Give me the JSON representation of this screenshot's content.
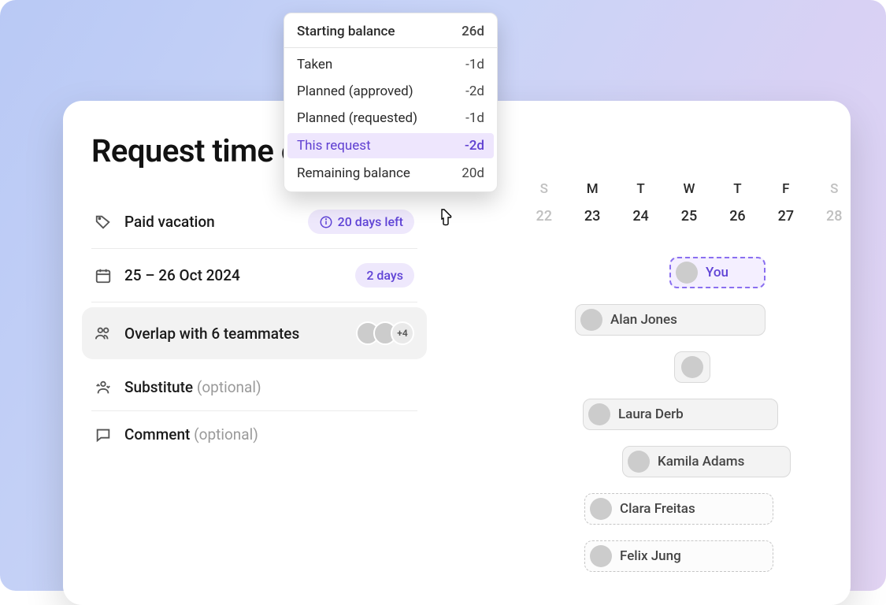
{
  "title": "Request time off",
  "form": {
    "type_label": "Paid vacation",
    "balance_pill": "20 days left",
    "date_label": "25 – 26 Oct 2024",
    "duration_pill": "2 days",
    "overlap_label": "Overlap with 6 teammates",
    "overlap_more": "+4",
    "substitute_label": "Substitute",
    "substitute_optional": "(optional)",
    "comment_label": "Comment",
    "comment_optional": "(optional)"
  },
  "tooltip": {
    "starting_label": "Starting balance",
    "starting_value": "26d",
    "rows": [
      {
        "label": "Taken",
        "value": "-1d"
      },
      {
        "label": "Planned (approved)",
        "value": "-2d"
      },
      {
        "label": "Planned (requested)",
        "value": "-1d"
      }
    ],
    "this_label": "This request",
    "this_value": "-2d",
    "remaining_label": "Remaining balance",
    "remaining_value": "20d"
  },
  "calendar": {
    "dow": [
      "S",
      "M",
      "T",
      "W",
      "T",
      "F",
      "S"
    ],
    "dates": [
      "22",
      "23",
      "24",
      "25",
      "26",
      "27",
      "28"
    ]
  },
  "overlaps": [
    {
      "name": "You"
    },
    {
      "name": "Alan Jones"
    },
    {
      "name": ""
    },
    {
      "name": "Laura Derb"
    },
    {
      "name": "Kamila Adams"
    },
    {
      "name": "Clara Freitas"
    },
    {
      "name": "Felix Jung"
    }
  ]
}
